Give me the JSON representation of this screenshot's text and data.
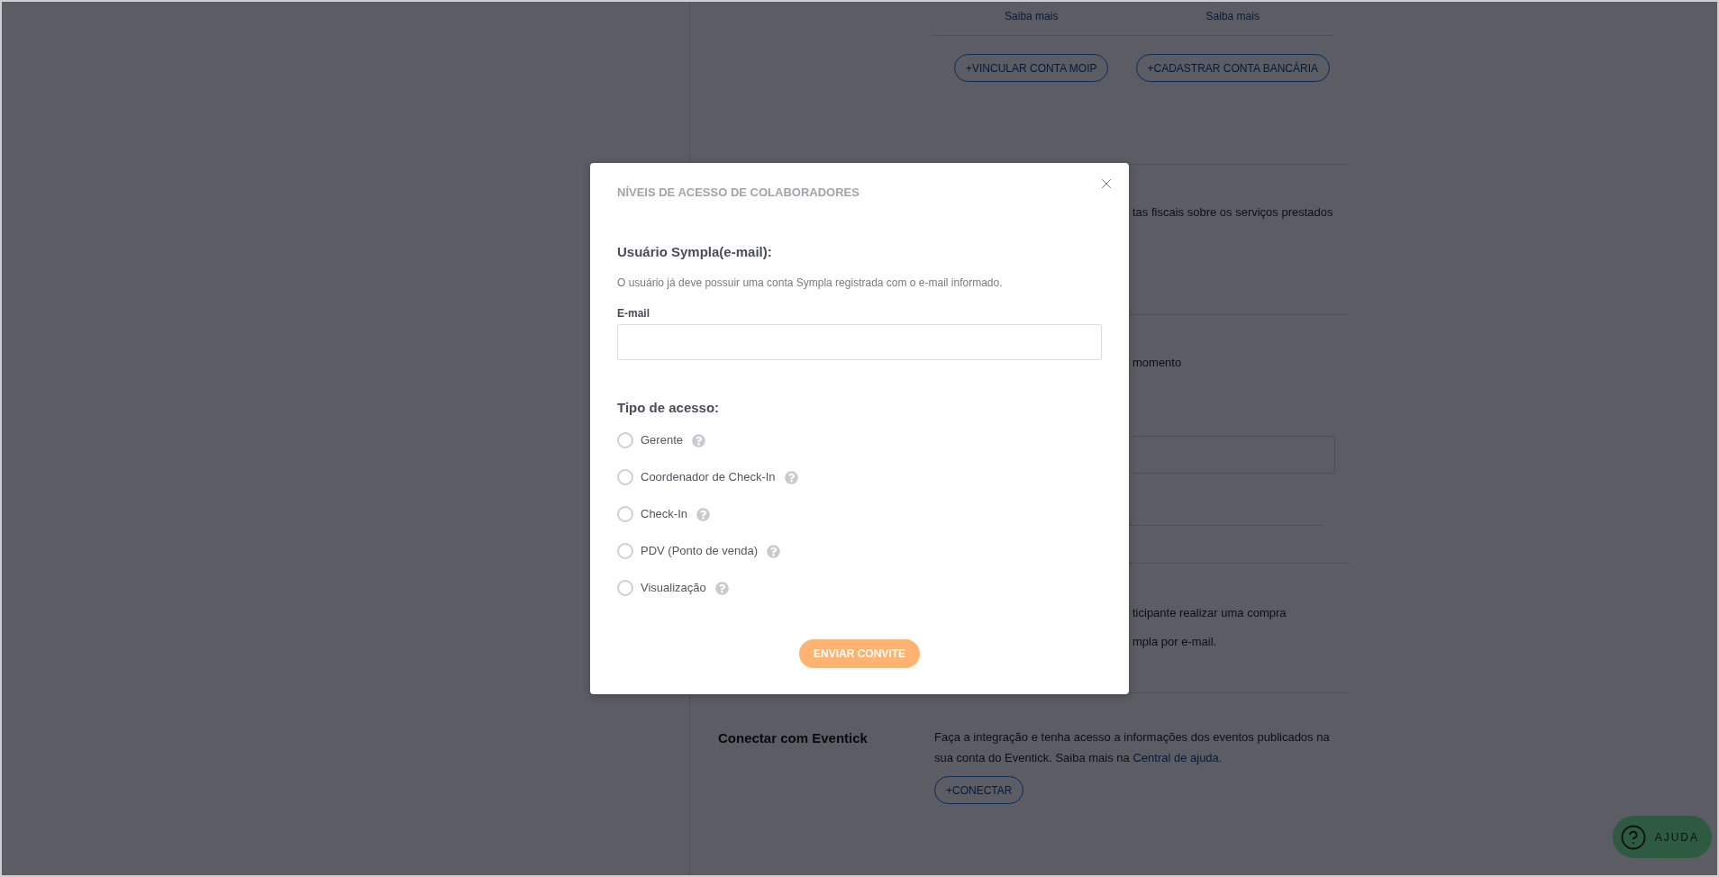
{
  "background_page": {
    "top_section": {
      "links": [
        "Saiba mais",
        "Saiba mais"
      ],
      "buttons": [
        "+VINCULAR CONTA MOIP",
        "+CADASTRAR CONTA BANCÁRIA"
      ]
    },
    "section_2": {
      "text": "tas fiscais sobre os serviços prestados"
    },
    "section_3": {
      "text": "momento"
    },
    "section_4": {
      "lines": [
        "ticipante realizar uma compra",
        "mpla por e-mail."
      ]
    },
    "eventick_section": {
      "title": "Conectar com Eventick",
      "description": "Faça a integração e tenha acesso a informações dos eventos publicados na sua conta do Eventick. Saiba mais na",
      "link": "Central de ajuda.",
      "button": "+CONECTAR"
    }
  },
  "modal": {
    "title": "NÍVEIS DE ACESSO DE COLABORADORES",
    "user_heading": "Usuário Sympla(e-mail):",
    "user_hint": "O usuário já deve possuir uma conta Sympla registrada com o e-mail informado.",
    "email_label": "E-mail",
    "access_heading": "Tipo de acesso:",
    "access_options": [
      {
        "label": "Gerente",
        "selected": false
      },
      {
        "label": "Coordenador de Check-In",
        "selected": false
      },
      {
        "label": "Check-In",
        "selected": false
      },
      {
        "label": "PDV (Ponto de venda)",
        "selected": false
      },
      {
        "label": "Visualização",
        "selected": false
      }
    ],
    "submit_button": "ENVIAR CONVITE"
  },
  "help_button": {
    "label": "AJUDA"
  }
}
